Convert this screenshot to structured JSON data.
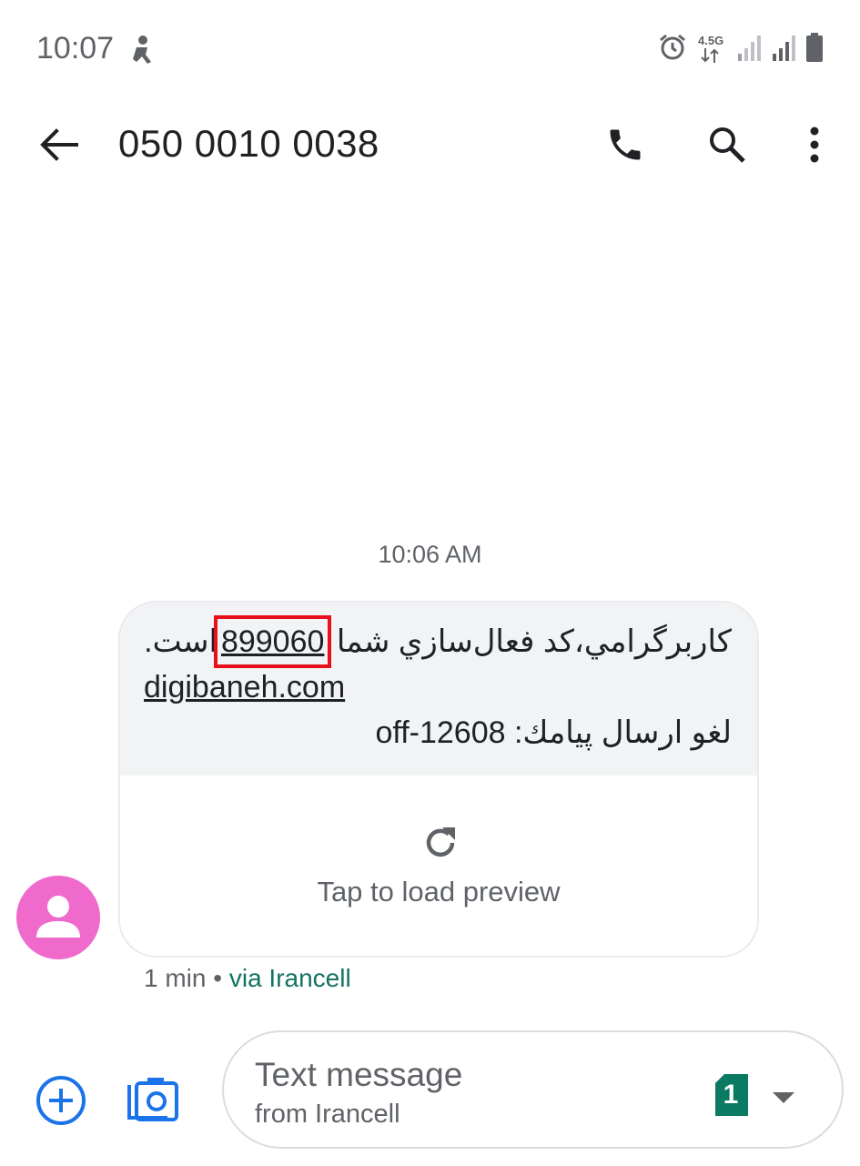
{
  "status_bar": {
    "time": "10:07",
    "network": "4.5G",
    "icons": [
      "accessibility-person-icon",
      "alarm-icon",
      "data-arrows-icon",
      "signal-weak-icon",
      "signal-icon",
      "battery-icon"
    ]
  },
  "app_bar": {
    "title": "050 0010 0038",
    "icons": [
      "arrow-back-icon",
      "phone-icon",
      "search-icon",
      "more-vert-icon"
    ]
  },
  "conversation": {
    "timestamp": "10:06 AM",
    "message": {
      "line1_prefix": "کاربرگرامي،کد فعال‌سازي شما",
      "code": "899060",
      "line1_suffix": "است.",
      "link": "digibaneh.com",
      "line3_label": "لغو ارسال پيامك:",
      "line3_value": "off-12608"
    },
    "preview_label": "Tap to load preview",
    "meta_time": "1 min",
    "meta_separator": "•",
    "meta_via": "via Irancell"
  },
  "compose": {
    "placeholder": "Text message",
    "subtext": "from Irancell",
    "sim_number": "1"
  },
  "colors": {
    "avatar": "#f06acb",
    "accent_blue": "#1a73e8",
    "sim_green": "#0b7a62",
    "highlight_red": "#e8101b",
    "bubble_bg": "#f1f3f4"
  }
}
